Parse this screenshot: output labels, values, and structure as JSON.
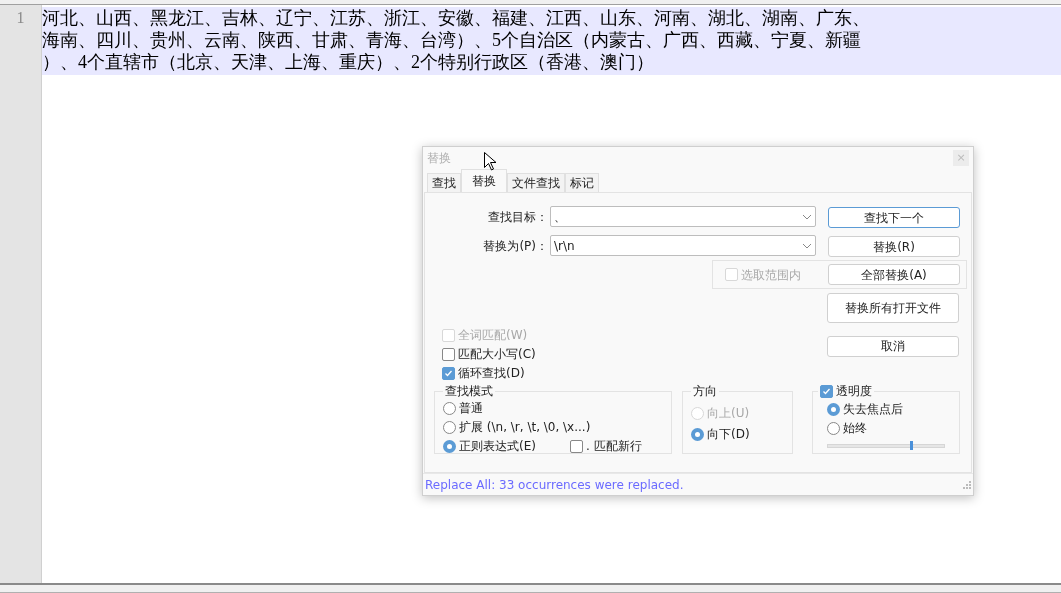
{
  "editor": {
    "line_number": "1",
    "text_rows": [
      "河北、山西、黑龙江、吉林、辽宁、江苏、浙江、安徽、福建、江西、山东、河南、湖北、湖南、广东、",
      "海南、四川、贵州、云南、陕西、甘肃、青海、台湾）、5个自治区（内蒙古、广西、西藏、宁夏、新疆",
      "）、4个直辖市（北京、天津、上海、重庆）、2个特别行政区（香港、澳门）"
    ]
  },
  "dialog": {
    "title": "替换",
    "close": "×",
    "tabs": [
      {
        "label": "查找",
        "selected": false
      },
      {
        "label": "替换",
        "selected": true
      },
      {
        "label": "文件查找",
        "selected": false
      },
      {
        "label": "标记",
        "selected": false
      }
    ],
    "find_label": "查找目标：",
    "find_value": "、",
    "replace_label": "替换为(P)：",
    "replace_value": "\\r\\n",
    "in_selection": {
      "label": "选取范围内",
      "checked": false,
      "disabled": true
    },
    "buttons": {
      "find_next": "查找下一个",
      "replace": "替换(R)",
      "replace_all": "全部替换(A)",
      "replace_all_files": "替换所有打开文件",
      "cancel": "取消"
    },
    "options": [
      {
        "label": "全词匹配(W)",
        "checked": false,
        "disabled": true
      },
      {
        "label": "匹配大小写(C)",
        "checked": false,
        "disabled": false
      },
      {
        "label": "循环查找(D)",
        "checked": true,
        "disabled": false
      }
    ],
    "search_mode": {
      "title": "查找模式",
      "items": [
        {
          "label": "普通",
          "selected": false
        },
        {
          "label": "扩展 (\\n, \\r, \\t, \\0, \\x...)",
          "selected": false
        },
        {
          "label": "正则表达式(E)",
          "selected": true
        }
      ],
      "dot_newline": {
        "label": ". 匹配新行",
        "checked": false
      }
    },
    "direction": {
      "title": "方向",
      "items": [
        {
          "label": "向上(U)",
          "selected": false,
          "disabled": true
        },
        {
          "label": "向下(D)",
          "selected": true,
          "disabled": false
        }
      ]
    },
    "transparency": {
      "title": "透明度",
      "checked": true,
      "items": [
        {
          "label": "失去焦点后",
          "selected": true
        },
        {
          "label": "始终",
          "selected": false
        }
      ],
      "level": 0.71
    },
    "status": "Replace All: 33 occurrences were replaced."
  }
}
